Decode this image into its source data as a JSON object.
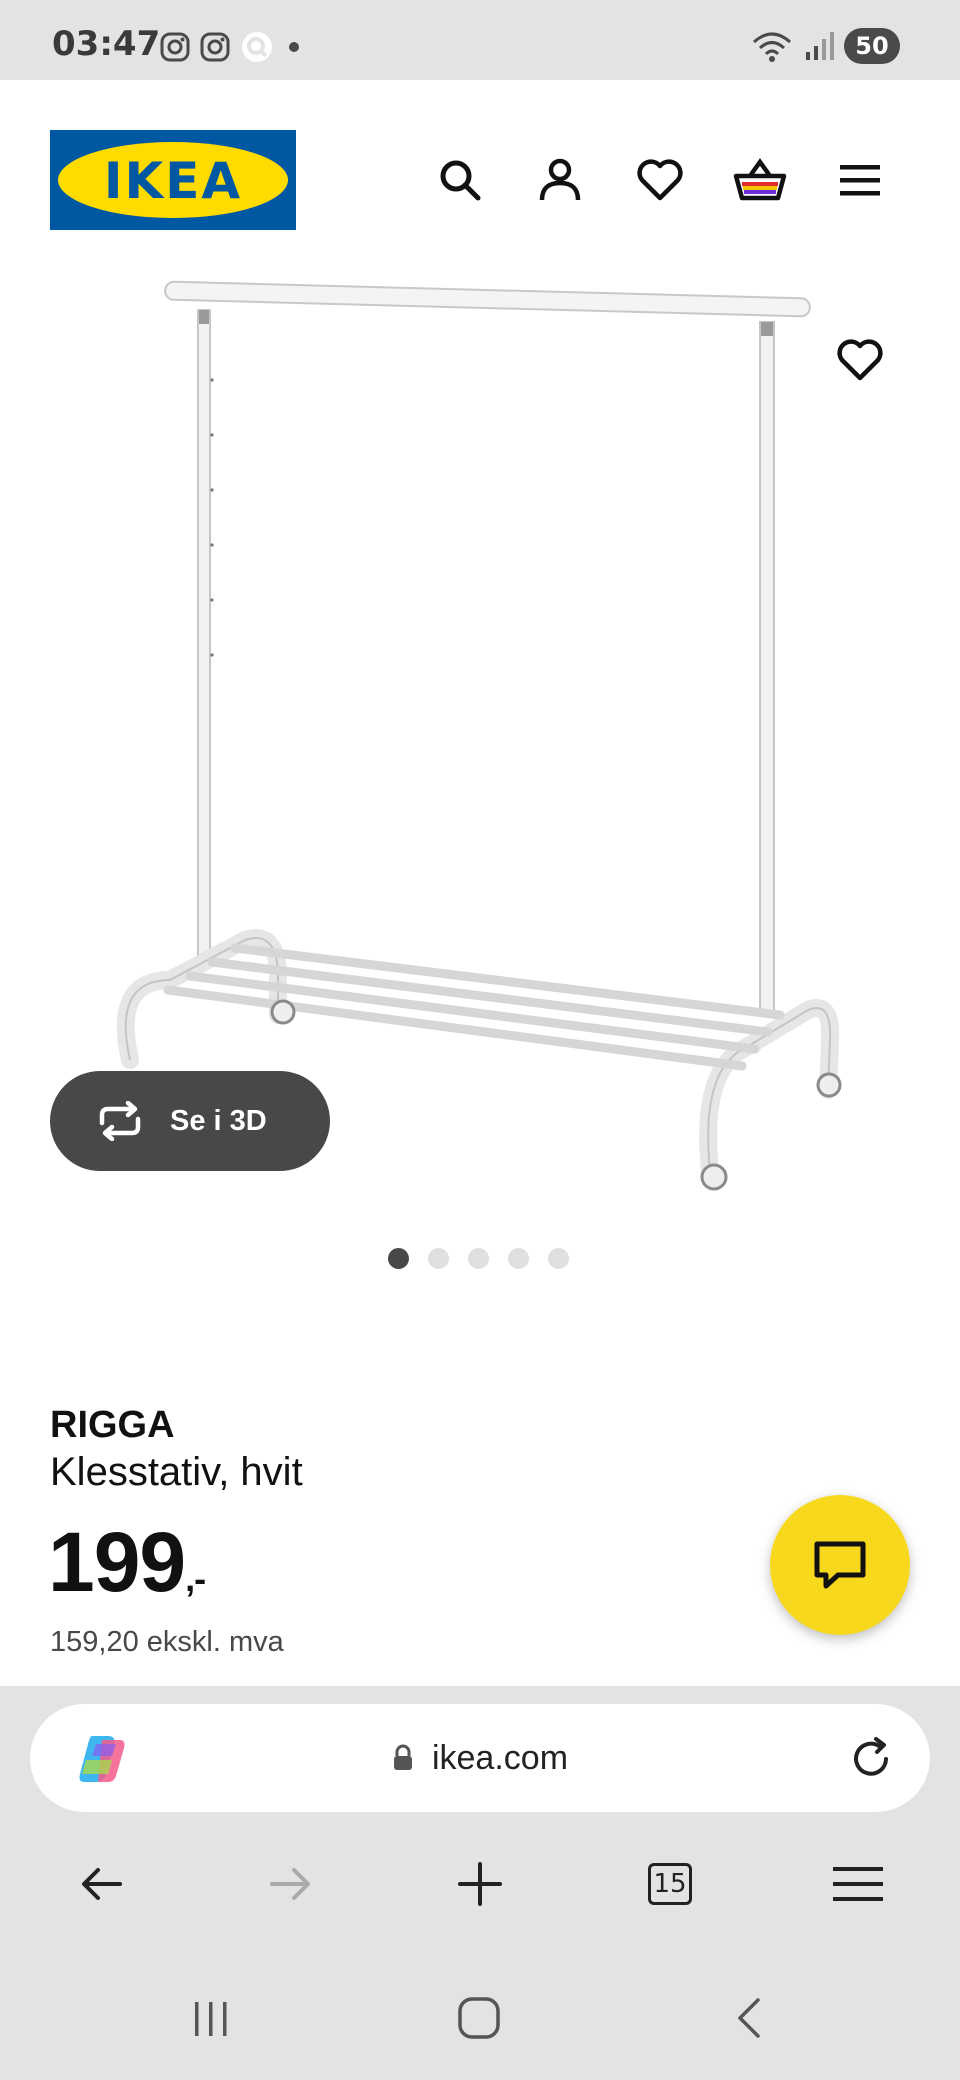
{
  "status_bar": {
    "time": "03:47",
    "left_icons": [
      "instagram-icon",
      "instagram-icon",
      "q-app-icon",
      "dot-icon"
    ],
    "right_icons": [
      "wifi-icon",
      "signal-icon"
    ],
    "battery": "50"
  },
  "header": {
    "logo_text": "IKEA",
    "icons": [
      "search-icon",
      "account-icon",
      "heart-icon",
      "basket-icon",
      "menu-icon"
    ]
  },
  "gallery": {
    "view_3d_label": "Se i 3D",
    "slide_count": 5,
    "active_slide": 1
  },
  "product": {
    "name": "RIGGA",
    "description": "Klesstativ, hvit",
    "price": "199",
    "price_suffix": ",-",
    "price_ex_vat": "159,20 ekskl. mva"
  },
  "browser": {
    "url": "ikea.com",
    "tab_count": "15"
  },
  "colors": {
    "ikea_blue": "#0058a3",
    "ikea_yellow": "#ffdb00",
    "chat_yellow": "#f7d81c",
    "dark_button": "#484848"
  }
}
